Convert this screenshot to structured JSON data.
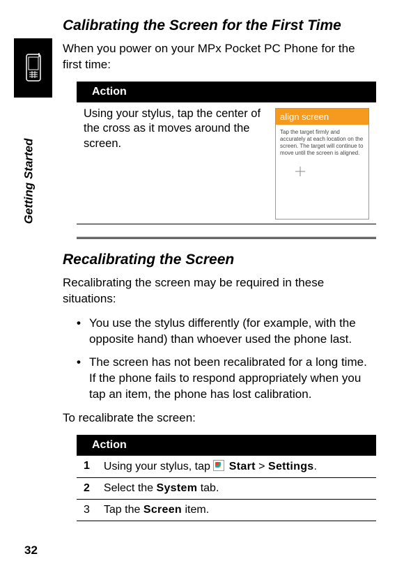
{
  "sideLabel": "Getting Started",
  "pageNumber": "32",
  "sec1": {
    "title": "Calibrating the Screen for the First Time",
    "intro": "When you power on your MPx Pocket PC Phone for the first time:",
    "actionHeader": "Action",
    "actionText": "Using your stylus, tap the center of the cross as it moves around the screen.",
    "screenTitle": "align screen",
    "screenText": "Tap the target firmly and accurately at each location on the screen. The target will continue to move until the screen is aligned."
  },
  "sec2": {
    "title": "Recalibrating the Screen",
    "intro": "Recalibrating the screen may be required in these situations:",
    "bullet1": "You use the stylus differently (for example, with the opposite hand) than whoever used the phone last.",
    "bullet2": "The screen has not been recalibrated for a long time. If the phone fails to respond appropriately when you tap an item, the phone has lost calibration.",
    "intro2": "To recalibrate the screen:",
    "actionHeader": "Action",
    "steps": {
      "s1pre": "Using your stylus, tap ",
      "s1start": "Start",
      "s1gt": " > ",
      "s1settings": "Settings",
      "s1period": ".",
      "s2a": "Select the ",
      "s2b": "System",
      "s2c": " tab.",
      "s3a": "Tap the ",
      "s3b": "Screen",
      "s3c": " item.",
      "n1": "1",
      "n2": "2",
      "n3": "3"
    }
  }
}
